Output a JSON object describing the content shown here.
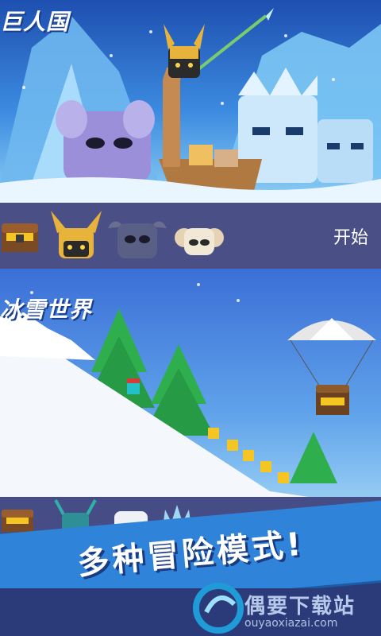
{
  "panels": [
    {
      "title": "巨人国"
    },
    {
      "title": "冰雪世界"
    }
  ],
  "toolbar": {
    "start_label": "开始",
    "icons": [
      "treasure-chest-icon",
      "horned-helmet-icon",
      "dark-giant-icon",
      "ram-skull-icon"
    ]
  },
  "banner": {
    "text": "多种冒险模式!"
  },
  "watermark": {
    "title": "偶要下载站",
    "url": "ouyaoxiazai.com"
  },
  "colors": {
    "toolbar": "#4a4f86",
    "banner": "#2f83d8",
    "sky_top": "#1e4fb0",
    "coin": "#f5c623",
    "tree": "#2fae4e"
  }
}
